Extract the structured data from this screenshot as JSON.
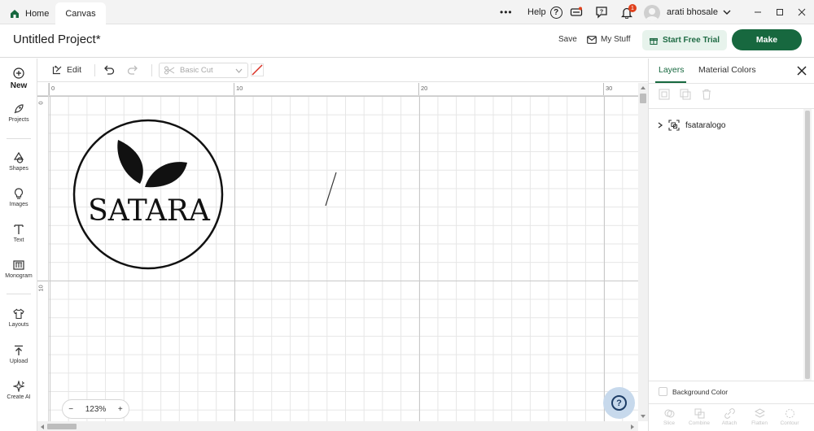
{
  "titlebar": {
    "tabs": [
      {
        "label": "Home",
        "icon": "home-icon"
      },
      {
        "label": "Canvas"
      }
    ],
    "more_label": "•••",
    "help_label": "Help",
    "notification_count": "1",
    "user_name": "arati bhosale",
    "brand_color": "#17683f"
  },
  "header": {
    "title": "Untitled Project*",
    "save_label": "Save",
    "my_stuff_label": "My Stuff",
    "trial_label": "Start Free Trial",
    "make_label": "Make"
  },
  "sidebar": {
    "new_label": "New",
    "items": [
      {
        "label": "Projects",
        "icon": "rocket-icon"
      },
      {
        "label": "Shapes",
        "icon": "shapes-icon"
      },
      {
        "label": "Images",
        "icon": "lightbulb-icon"
      },
      {
        "label": "Text",
        "icon": "text-icon"
      },
      {
        "label": "Monogram",
        "icon": "monogram-icon"
      },
      {
        "label": "Layouts",
        "icon": "shirt-icon"
      },
      {
        "label": "Upload",
        "icon": "upload-icon"
      },
      {
        "label": "Create AI",
        "icon": "sparkle-icon"
      }
    ]
  },
  "toolbar": {
    "edit_label": "Edit",
    "operation_value": "Basic Cut"
  },
  "canvas": {
    "ruler_top": [
      "0",
      "10",
      "20",
      "30"
    ],
    "ruler_left": [
      "0",
      "10"
    ],
    "logo_text": "SATARA",
    "zoom_minus": "−",
    "zoom_value": "123%",
    "zoom_plus": "+",
    "help_label": "?"
  },
  "right_panel": {
    "tabs": [
      {
        "label": "Layers",
        "active": true
      },
      {
        "label": "Material Colors",
        "active": false
      }
    ],
    "layers": [
      {
        "name": "fsataralogo",
        "icon": "group-icon"
      }
    ],
    "background_color_label": "Background Color",
    "bottom_tools": [
      "Slice",
      "Combine",
      "Attach",
      "Flatten",
      "Contour"
    ]
  }
}
